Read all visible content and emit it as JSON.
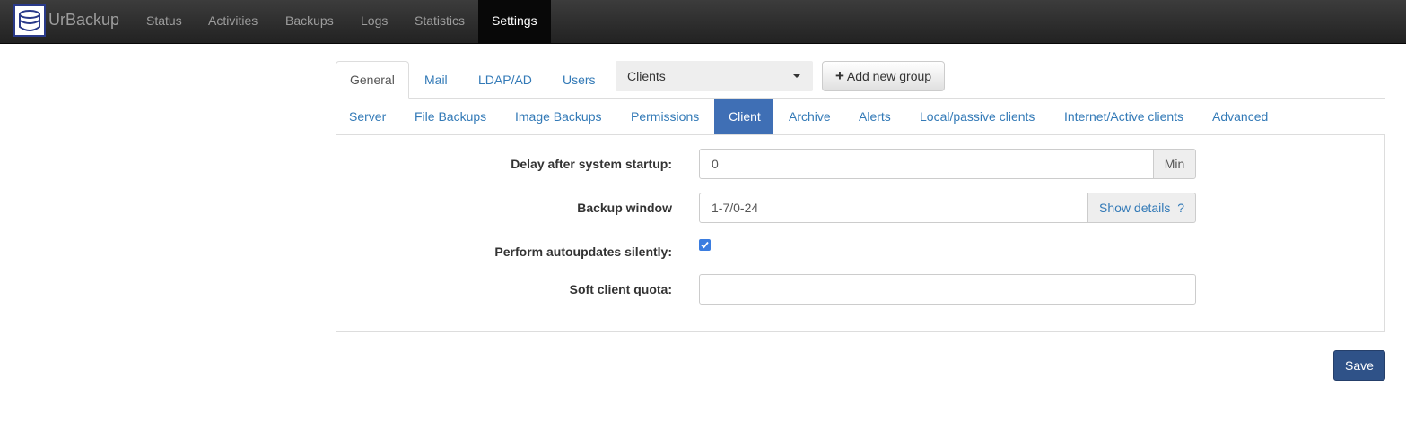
{
  "brand": {
    "name": "UrBackup",
    "logo_icon": "database-icon"
  },
  "nav": {
    "items": [
      {
        "label": "Status"
      },
      {
        "label": "Activities"
      },
      {
        "label": "Backups"
      },
      {
        "label": "Logs"
      },
      {
        "label": "Statistics"
      },
      {
        "label": "Settings",
        "active": true
      }
    ]
  },
  "settings_tabs": [
    {
      "label": "General",
      "active": true
    },
    {
      "label": "Mail"
    },
    {
      "label": "LDAP/AD"
    },
    {
      "label": "Users"
    }
  ],
  "group_select": {
    "value": "Clients"
  },
  "add_group_button": {
    "label": "Add new group",
    "icon": "plus-icon"
  },
  "sub_tabs": [
    {
      "label": "Server"
    },
    {
      "label": "File Backups"
    },
    {
      "label": "Image Backups"
    },
    {
      "label": "Permissions"
    },
    {
      "label": "Client",
      "active": true
    },
    {
      "label": "Archive"
    },
    {
      "label": "Alerts"
    },
    {
      "label": "Local/passive clients"
    },
    {
      "label": "Internet/Active clients"
    },
    {
      "label": "Advanced"
    }
  ],
  "form": {
    "delay": {
      "label": "Delay after system startup:",
      "value": "0",
      "unit": "Min"
    },
    "backup_window": {
      "label": "Backup window",
      "value": "1-7/0-24",
      "details": "Show details",
      "help": "?"
    },
    "autoupdate": {
      "label": "Perform autoupdates silently:",
      "checked": true
    },
    "quota": {
      "label": "Soft client quota:",
      "value": ""
    }
  },
  "save_button": {
    "label": "Save"
  },
  "colors": {
    "navbar": "#222222",
    "link": "#337ab7",
    "active_tab": "#3f6fb5",
    "save": "#2f5288"
  }
}
